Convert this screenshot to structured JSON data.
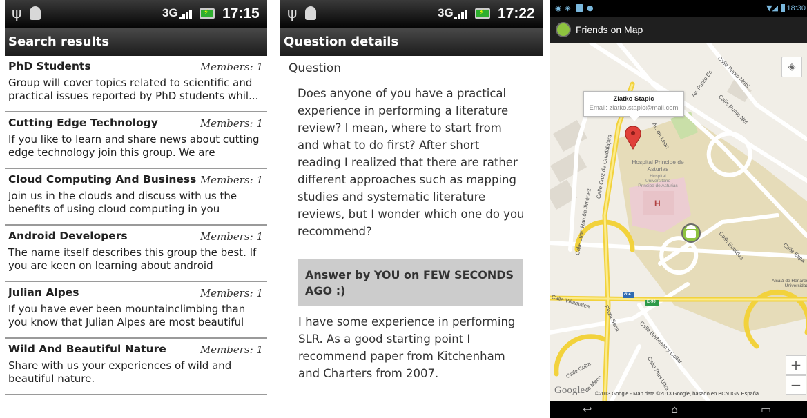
{
  "screen1": {
    "status_bar": {
      "network": "3G",
      "time": "17:15"
    },
    "title": "Search results",
    "groups": [
      {
        "name": "PhD Students",
        "members": "Members: 1",
        "description": "Group will cover topics related to scientific and practical issues reported by PhD students whil..."
      },
      {
        "name": "Cutting Edge Technology",
        "members": "Members: 1",
        "description": "If you like to learn and share news about cutting edge technology join this group. We are exchan..."
      },
      {
        "name": "Cloud Computing And Business",
        "members": "Members: 1",
        "description": "Join us in the clouds and discuss with us the benefits of using cloud computing in you"
      },
      {
        "name": "Android Developers",
        "members": "Members: 1",
        "description": "The name itself describes this group the best. If you are keen on learning about android develop..."
      },
      {
        "name": "Julian Alpes",
        "members": "Members: 1",
        "description": "If you have ever been mountainclimbing than you know that Julian Alpes are most beautiful mounta.."
      },
      {
        "name": "Wild And Beautiful Nature",
        "members": "Members: 1",
        "description": "Share with us your experiences of wild and beautiful nature."
      }
    ]
  },
  "screen2": {
    "status_bar": {
      "network": "3G",
      "time": "17:22"
    },
    "title": "Question details",
    "question_label": "Question",
    "question_text": "Does anyone of you have a practical experience in performing a literature review? I mean, where to start from and what to do first? After short reading I realized that there are rather different approaches such as mapping studies and systematic literature reviews, but I wonder which one do you recommend?",
    "answer_header": "Answer by YOU on FEW SECONDS AGO :)",
    "answer_text": "I have some experience in performing SLR. As a good starting point I recommend paper from Kitchenham and Charters from 2007."
  },
  "screen3": {
    "status_bar": {
      "time": "18:30"
    },
    "app_title": "Friends on Map",
    "info_window": {
      "name": "Zlatko Stapic",
      "email": "Email: zlatko.stapic@mail.com"
    },
    "map_labels": {
      "hospital": "Hospital Principe de Asturias",
      "hospital_sub": "Hospital Universitario Principe de Asturias",
      "hospital_marker": "H",
      "calle_punto_mobi": "Calle Punto Mobi",
      "av_punto_es": "Av. Punto Es",
      "calle_punto_net": "Calle Punto Net",
      "av_leon": "Av. de León",
      "calle_cruz": "Calle Cruz de Guadalajara",
      "calle_juan_ramon": "Calle Juan Ramón Jiménez",
      "calle_euclides": "Calle Euclides",
      "calle_espana": "Calle Espa",
      "alcala": "Alcalá de Henares Universidad",
      "calle_villamalea": "Calle Villamalea",
      "plaza_sena": "Plaza Sena",
      "calle_barberan": "Calle Barberán y Collar",
      "calle_cuba": "Calle Cuba",
      "calle_plus": "Calle Plus Ultra",
      "meco": "de Meco",
      "road_a2": "A-2",
      "road_e90": "E-90"
    },
    "google_logo": "Google",
    "copyright": "©2013 Google - Map data ©2013 Google, basado en BCN IGN España",
    "zoom_in": "+",
    "zoom_out": "−",
    "colors": {
      "park": "#c9dfa8",
      "hospital_area": "#eccdd2",
      "campus": "#e6dcb9",
      "highway": "#f7e46a",
      "road": "#ffffff"
    }
  }
}
